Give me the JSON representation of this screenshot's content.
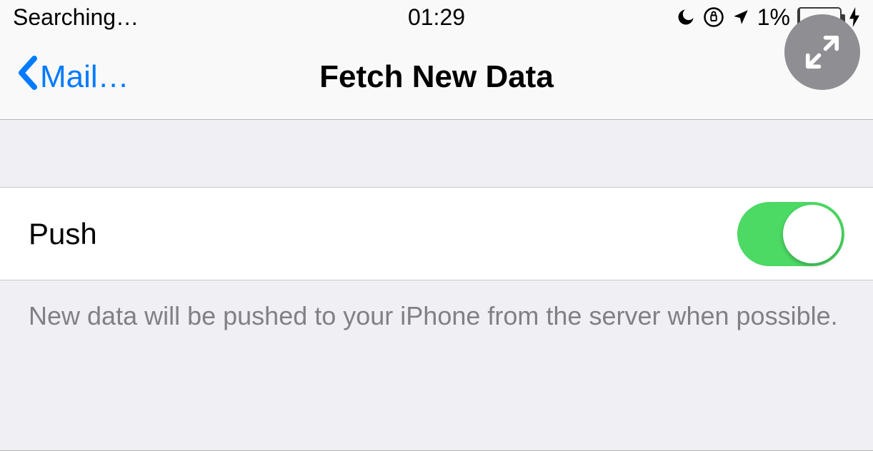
{
  "status": {
    "carrier": "Searching…",
    "time": "01:29",
    "battery_percent": "1%"
  },
  "nav": {
    "back_label": "Mail…",
    "title": "Fetch New Data"
  },
  "row": {
    "push_label": "Push"
  },
  "footer": {
    "text": "New data will be pushed to your iPhone from the server when possible."
  }
}
